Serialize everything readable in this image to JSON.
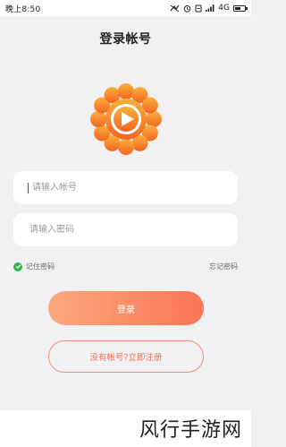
{
  "status_bar": {
    "time": "晚上8:50",
    "network": "4G"
  },
  "header": {
    "title": "登录帐号"
  },
  "form": {
    "username_placeholder": "请输入帐号",
    "password_placeholder": "请输入密码",
    "remember_label": "记住密码",
    "forgot_label": "忘记密码",
    "login_label": "登录",
    "register_label": "没有帐号?立即注册"
  },
  "watermark": {
    "text": "风行手游网"
  },
  "colors": {
    "accent": "#fb7455",
    "accent_light": "#fca87d",
    "logo_orange": "#f58a1f",
    "check_green": "#37b24d",
    "background": "#f1f1f3"
  },
  "icons": [
    "signal-icon",
    "alarm-icon",
    "wifi-icon",
    "cellular-icon",
    "battery-icon",
    "app-logo-icon",
    "check-icon"
  ],
  "battery_level": 0.6
}
